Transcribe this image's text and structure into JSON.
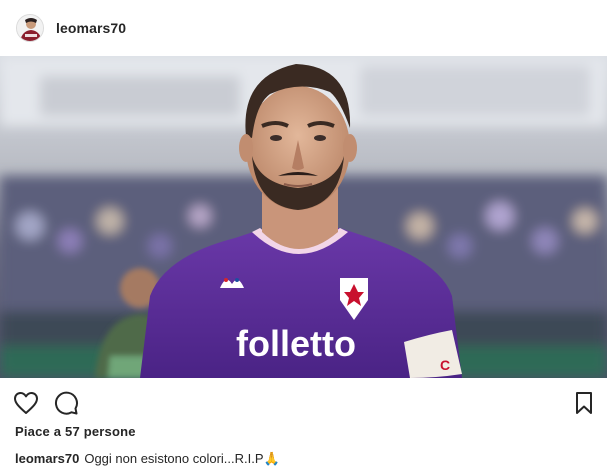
{
  "post": {
    "username": "leomars70",
    "likes_text": "Piace a 57 persone",
    "caption_user": "leomars70",
    "caption_text": "Oggi non esistono colori...R.I.P",
    "caption_emoji": "🙏"
  },
  "photo": {
    "jersey_text": "folletto",
    "jersey_color": "#5a2d91",
    "armband_text": "C"
  },
  "icons": {
    "like": "heart-icon",
    "comment": "comment-icon",
    "save": "bookmark-icon"
  },
  "colors": {
    "text": "#262626",
    "background": "#ffffff",
    "avatar_jersey": "#8b1e2d"
  }
}
